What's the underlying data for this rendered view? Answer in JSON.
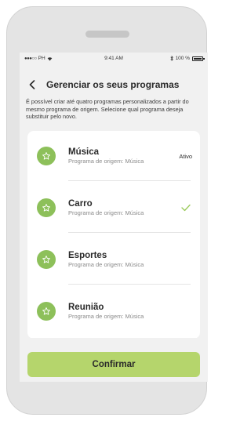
{
  "status_bar": {
    "carrier": "PH",
    "time": "9:41 AM",
    "battery_text": "100 %"
  },
  "header": {
    "title": "Gerenciar os seus programas",
    "back_icon": "chevron-left-icon"
  },
  "description": "É possível criar até quatro programas personalizados a partir do mesmo programa de origem. Selecione qual programa deseja substituir pelo novo.",
  "programs": [
    {
      "name": "Música",
      "origin": "Programa de origem: Música",
      "status": "Ativo",
      "selected": false,
      "icon": "star-icon"
    },
    {
      "name": "Carro",
      "origin": "Programa de origem: Música",
      "status": "",
      "selected": true,
      "icon": "star-icon"
    },
    {
      "name": "Esportes",
      "origin": "Programa de origem: Música",
      "status": "",
      "selected": false,
      "icon": "star-icon"
    },
    {
      "name": "Reunião",
      "origin": "Programa de origem: Música",
      "status": "",
      "selected": false,
      "icon": "star-icon"
    }
  ],
  "confirm_label": "Confirmar",
  "colors": {
    "accent_green": "#8dc05a",
    "button_green": "#b5d56c",
    "check_green": "#9ccb5e",
    "background": "#f1f1f1"
  }
}
